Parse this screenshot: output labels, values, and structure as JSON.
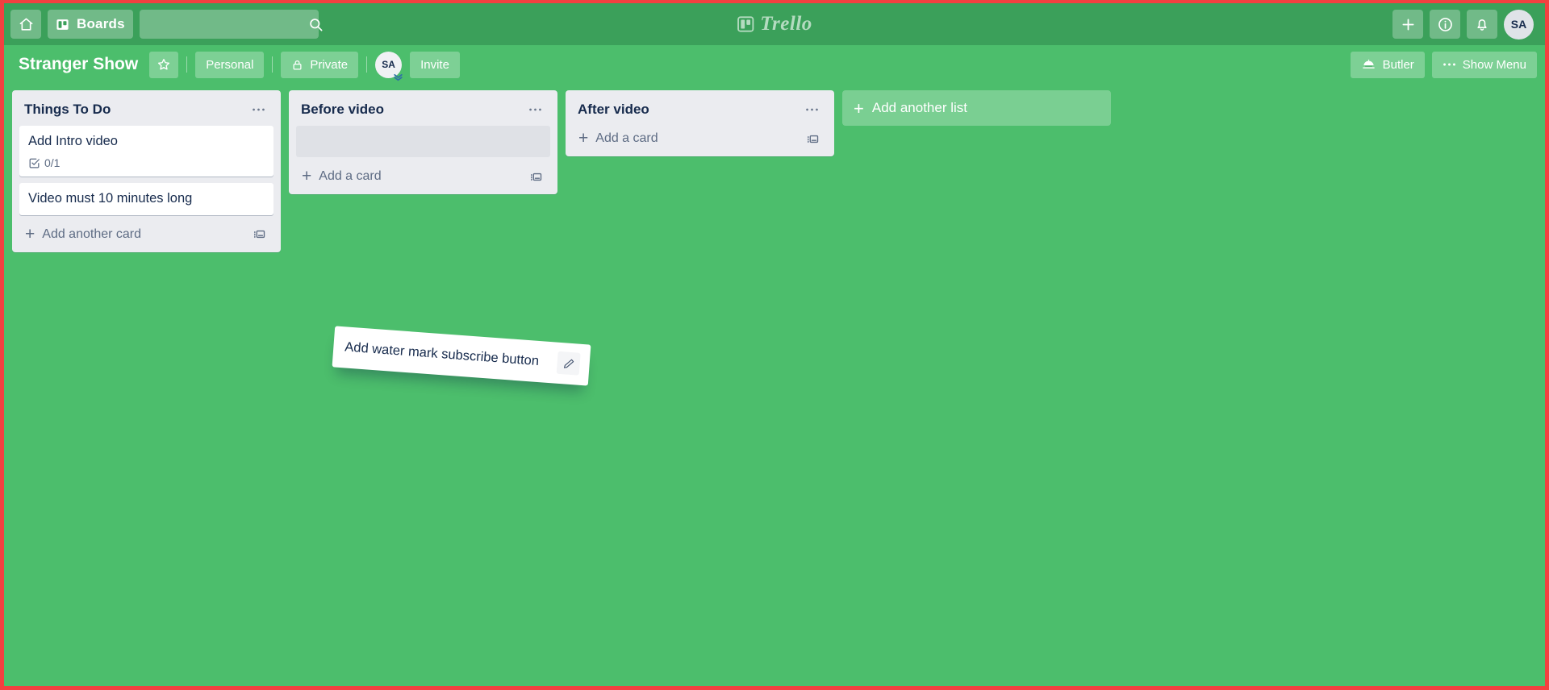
{
  "topnav": {
    "home_icon": "home-icon",
    "boards_label": "Boards",
    "boards_icon": "board-icon",
    "search_value": "",
    "search_placeholder": "",
    "search_icon": "search-icon",
    "logo_text": "Trello",
    "logo_icon": "trello-board-icon",
    "add_icon": "plus-icon",
    "info_icon": "info-circle-icon",
    "notifications_icon": "bell-icon",
    "avatar_initials": "SA"
  },
  "boardheader": {
    "title": "Stranger Show",
    "star_icon": "star-icon",
    "workspace_label": "Personal",
    "visibility_label": "Private",
    "visibility_icon": "lock-icon",
    "member_initials": "SA",
    "member_chevron": "chevron-double-down-icon",
    "invite_label": "Invite",
    "butler_label": "Butler",
    "butler_icon": "butler-dome-icon",
    "show_menu_label": "Show Menu",
    "show_menu_icon": "ellipsis-icon"
  },
  "board": {
    "add_list_label": "Add another list",
    "add_list_icon": "plus-icon",
    "lists": [
      {
        "title": "Things To Do",
        "menu_icon": "ellipsis-icon",
        "cards": [
          {
            "title": "Add Intro video",
            "checklist_icon": "checklist-icon",
            "checklist": "0/1"
          },
          {
            "title": "Video must 10 minutes long"
          }
        ],
        "has_placeholder": false,
        "add_card_label": "Add another card",
        "add_card_icon": "plus-icon",
        "template_icon": "card-template-icon"
      },
      {
        "title": "Before video",
        "menu_icon": "ellipsis-icon",
        "cards": [],
        "has_placeholder": true,
        "add_card_label": "Add a card",
        "add_card_icon": "plus-icon",
        "template_icon": "card-template-icon"
      },
      {
        "title": "After video",
        "menu_icon": "ellipsis-icon",
        "cards": [],
        "has_placeholder": false,
        "add_card_label": "Add a card",
        "add_card_icon": "plus-icon",
        "template_icon": "card-template-icon"
      }
    ]
  },
  "drag_card": {
    "title": "Add water mark subscribe button",
    "edit_icon": "pencil-icon"
  },
  "colors": {
    "board_background": "#4cbe6c",
    "topnav_background": "#3ba05a",
    "list_background": "#ebecf0",
    "card_background": "#ffffff",
    "text_primary": "#172b4d",
    "text_muted": "#5e6c84",
    "screenshot_border": "#f24040"
  }
}
